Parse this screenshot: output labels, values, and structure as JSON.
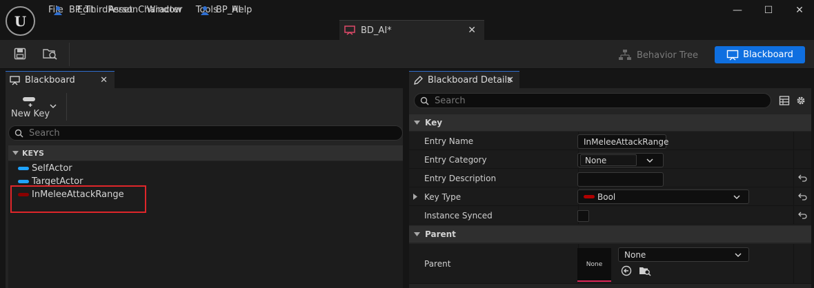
{
  "app": {
    "logo_text": "U"
  },
  "menu": [
    "File",
    "Edit",
    "Asset",
    "Window",
    "Tools",
    "Help"
  ],
  "window_controls": {
    "minimize": "—",
    "maximize": "☐",
    "close": "✕"
  },
  "document_tabs": [
    {
      "label": "BP_ThirdPersonCharacter",
      "icon": "blueprint-pawn-icon",
      "active": false
    },
    {
      "label": "BP_AI",
      "icon": "blueprint-pawn-icon",
      "active": false
    },
    {
      "label": "BD_AI*",
      "icon": "blackboard-asset-icon",
      "active": true,
      "close": "✕"
    }
  ],
  "toolbar": {
    "save_icon": "save-icon",
    "browse_icon": "browse-asset-icon",
    "mode_behavior_tree": "Behavior Tree",
    "mode_blackboard": "Blackboard"
  },
  "blackboard_panel": {
    "tab_label": "Blackboard",
    "tab_close": "✕",
    "new_key_label": "New Key",
    "search_placeholder": "Search",
    "keys_header": "KEYS",
    "keys": [
      {
        "name": "SelfActor",
        "color": "#1fa3ff"
      },
      {
        "name": "TargetActor",
        "color": "#1fa3ff"
      },
      {
        "name": "InMeleeAttackRange",
        "color": "#8b0000"
      }
    ]
  },
  "details_panel": {
    "tab_label": "Blackboard Details",
    "tab_close": "✕",
    "search_placeholder": "Search",
    "sections": {
      "key": "Key",
      "parent": "Parent"
    },
    "rows": {
      "entry_name": {
        "label": "Entry Name",
        "value": "InMeleeAttackRange"
      },
      "entry_category": {
        "label": "Entry Category",
        "value": "None"
      },
      "entry_description": {
        "label": "Entry Description",
        "value": ""
      },
      "key_type": {
        "label": "Key Type",
        "value": "Bool",
        "color": "#b00000"
      },
      "instance_synced": {
        "label": "Instance Synced",
        "checked": false
      },
      "parent": {
        "label": "Parent",
        "thumb_text": "None",
        "value": "None"
      }
    }
  },
  "colors": {
    "accent": "#0f6fe0",
    "highlight": "#e0262a",
    "object_key": "#1fa3ff",
    "bool_key": "#8b0000"
  }
}
